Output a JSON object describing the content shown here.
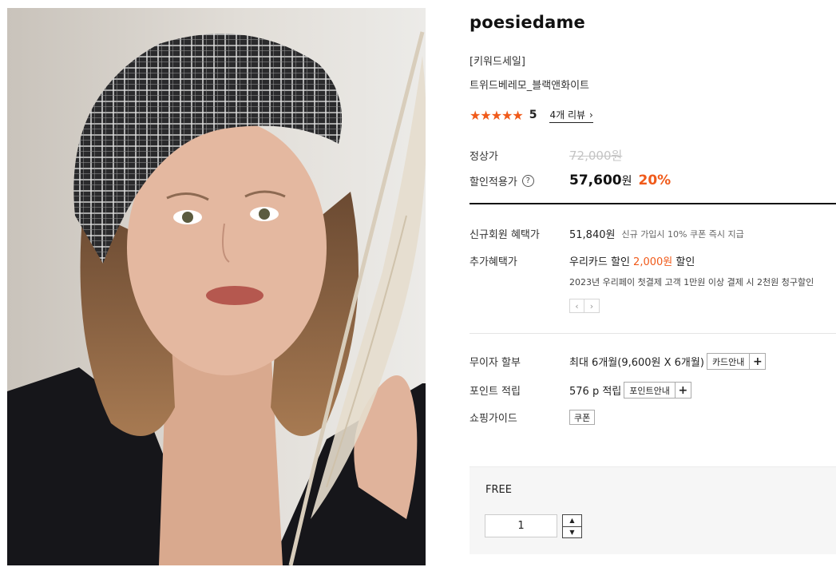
{
  "product": {
    "brand": "poesiedame",
    "tagline": "[키워드세일]",
    "name": "트위드베레모_블랙앤화이트",
    "rating_value": "5",
    "stars_filled": 5,
    "stars_glyphs": "★★★★★",
    "review_link": "4개 리뷰",
    "review_chevron": "›"
  },
  "pricing": {
    "regular_label": "정상가",
    "regular_price": "72,000원",
    "sale_label": "할인적용가",
    "help_glyph": "?",
    "sale_price": "57,600",
    "sale_unit": "원",
    "discount_pct": "20%"
  },
  "benefits": {
    "new_member_label": "신규회원 혜택가",
    "new_member_price": "51,840원",
    "new_member_note": "신규 가입시 10% 쿠폰 즉시 지급",
    "extra_label": "추가혜택가",
    "extra_card": "우리카드",
    "extra_word1": "할인",
    "extra_amount": "2,000원",
    "extra_word2": "할인",
    "extra_note": "2023년 우리페이 첫결제 고객 1만원 이상 결제 시 2천원 청구할인",
    "pager_prev": "‹",
    "pager_next": "›"
  },
  "services": {
    "installment_label": "무이자 할부",
    "installment_value": "최대 6개월(9,600원 X 6개월)",
    "card_info_button": "카드안내",
    "plus_glyph": "+",
    "point_label": "포인트 적립",
    "point_value": "576 p 적립",
    "point_info_button": "포인트안내",
    "guide_label": "쇼핑가이드",
    "coupon_button": "쿠폰"
  },
  "option": {
    "name": "FREE",
    "quantity": "1",
    "up_glyph": "▲",
    "down_glyph": "▼"
  },
  "colors": {
    "accent": "#f05a1a",
    "text": "#222222",
    "muted_price": "#c4c4c4"
  }
}
